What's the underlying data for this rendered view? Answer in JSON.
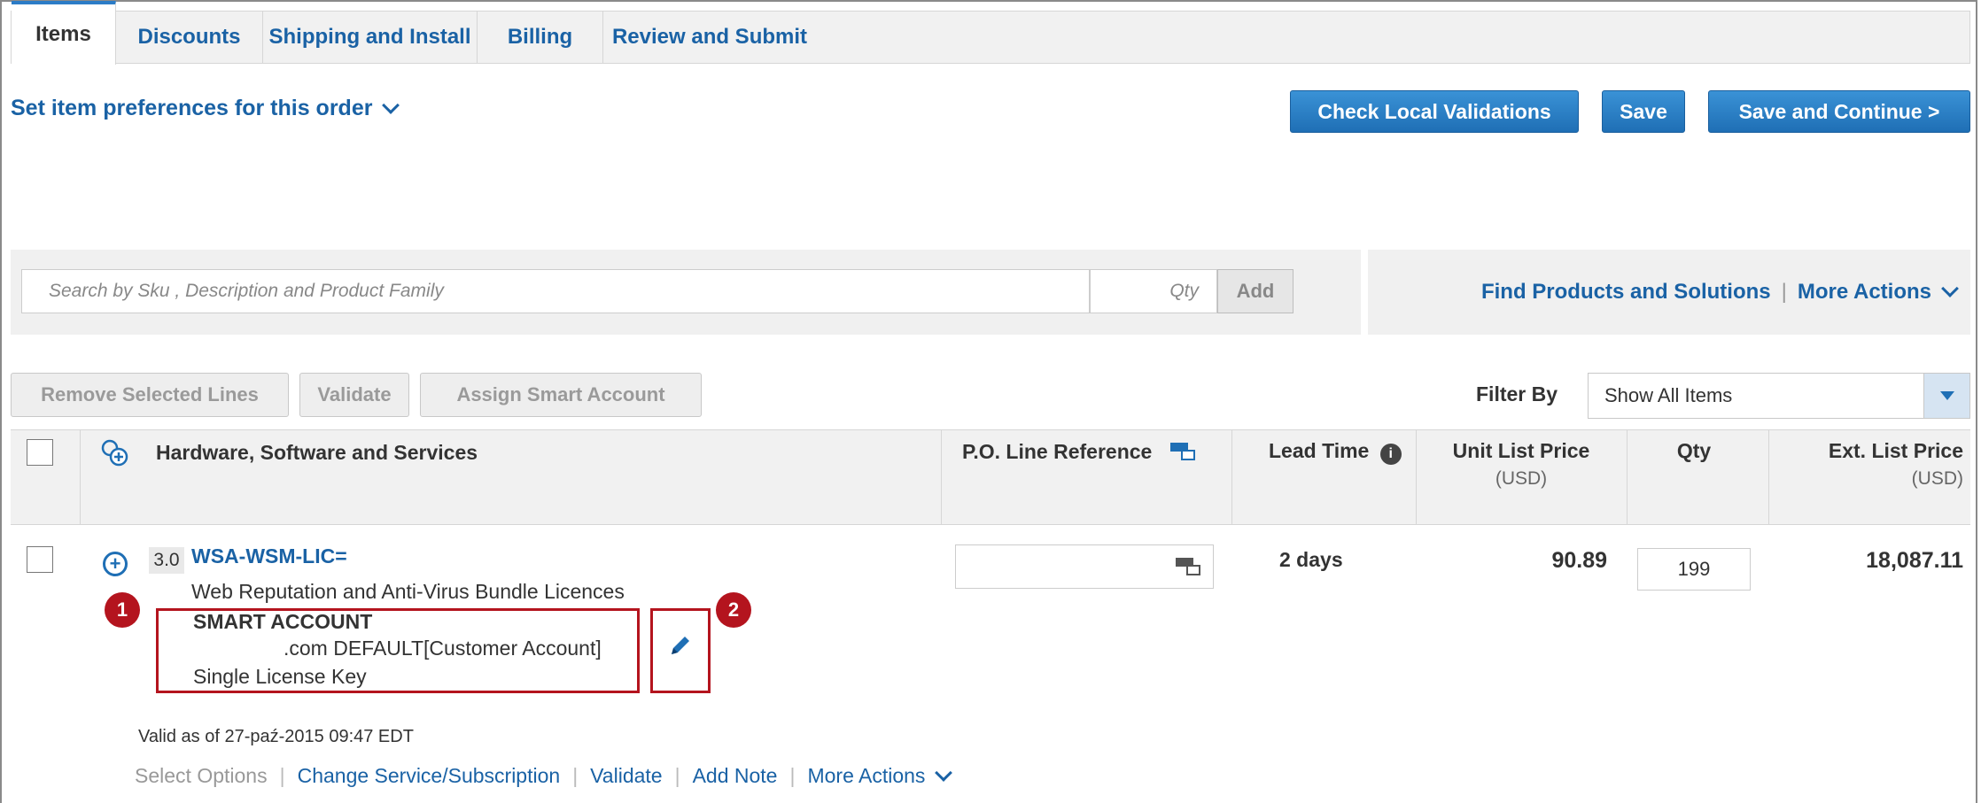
{
  "tabs": [
    {
      "label": "Items",
      "active": true
    },
    {
      "label": "Discounts"
    },
    {
      "label": "Shipping and Install"
    },
    {
      "label": "Billing"
    },
    {
      "label": "Review and Submit"
    }
  ],
  "preferences_link": "Set item preferences for this order",
  "buttons": {
    "check_local_validations": "Check Local Validations",
    "save": "Save",
    "save_and_continue": "Save and Continue >"
  },
  "search": {
    "placeholder": "Search by Sku , Description and  Product Family",
    "qty_placeholder": "Qty",
    "add": "Add"
  },
  "find_products": "Find Products and Solutions",
  "more_actions": "More Actions",
  "line_actions": {
    "remove": "Remove Selected Lines",
    "validate": "Validate",
    "assign_smart_account": "Assign Smart Account"
  },
  "filter": {
    "label": "Filter By",
    "value": "Show All Items"
  },
  "table": {
    "col_items": "Hardware, Software and Services",
    "col_po": "P.O. Line Reference",
    "col_lead": "Lead Time",
    "col_unit_price": "Unit List Price",
    "col_unit_price_sub": "(USD)",
    "col_qty": "Qty",
    "col_ext_price": "Ext. List Price",
    "col_ext_price_sub": "(USD)"
  },
  "item": {
    "line_number": "3.0",
    "sku": "WSA-WSM-LIC=",
    "description": "Web Reputation and Anti-Virus Bundle Licences",
    "smart_account_label": "SMART ACCOUNT",
    "smart_account_value": ".com DEFAULT[Customer Account]",
    "license": "Single License Key",
    "lead_time": "2 days",
    "unit_price": "90.89",
    "qty": "199",
    "ext_price": "18,087.11",
    "valid_as_of": "Valid as of 27-paź-2015 09:47 EDT"
  },
  "item_actions": {
    "select_options": "Select Options",
    "change_service": "Change Service/Subscription",
    "validate": "Validate",
    "add_note": "Add Note",
    "more_actions": "More Actions"
  },
  "callouts": {
    "one": "1",
    "two": "2"
  },
  "colors": {
    "accent": "#1f6fb5",
    "callout": "#b4141e"
  }
}
